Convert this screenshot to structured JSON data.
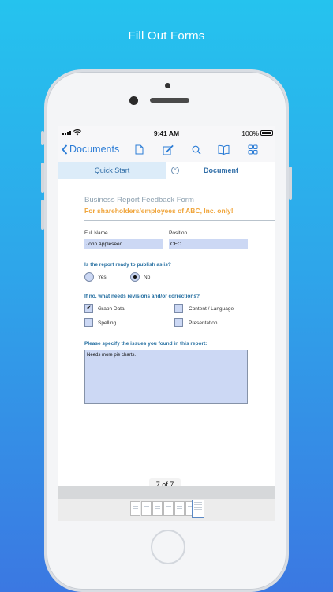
{
  "hero": {
    "title": "Fill Out Forms"
  },
  "status": {
    "time": "9:41 AM",
    "battery": "100%"
  },
  "nav": {
    "back_label": "Documents",
    "icons": [
      "document-icon",
      "edit-icon",
      "search-icon",
      "book-icon",
      "grid-icon"
    ]
  },
  "tabs": {
    "quick_start": "Quick Start",
    "document": "Document"
  },
  "form": {
    "title": "Business Report Feedback Form",
    "subtitle": "For shareholders/employees of ABC, Inc. only!",
    "full_name_label": "Full Name",
    "full_name_value": "John Appleseed",
    "position_label": "Position",
    "position_value": "CEO",
    "publish_question": "Is the report ready to publish as is?",
    "yes_label": "Yes",
    "no_label": "No",
    "publish_selected": "No",
    "revisions_question": "If no, what needs revisions and/or corrections?",
    "checkboxes": [
      {
        "label": "Graph Data",
        "checked": true
      },
      {
        "label": "Content / Language",
        "checked": false
      },
      {
        "label": "Spelling",
        "checked": false
      },
      {
        "label": "Presentation",
        "checked": false
      }
    ],
    "issues_question": "Please specify the issues you found in this report:",
    "issues_value": "Needs more pie charts."
  },
  "pager": {
    "indicator": "7 of 7"
  },
  "colors": {
    "accent": "#2b7cd6",
    "subtitle": "#f0a53b",
    "field": "#ccd8f4"
  }
}
